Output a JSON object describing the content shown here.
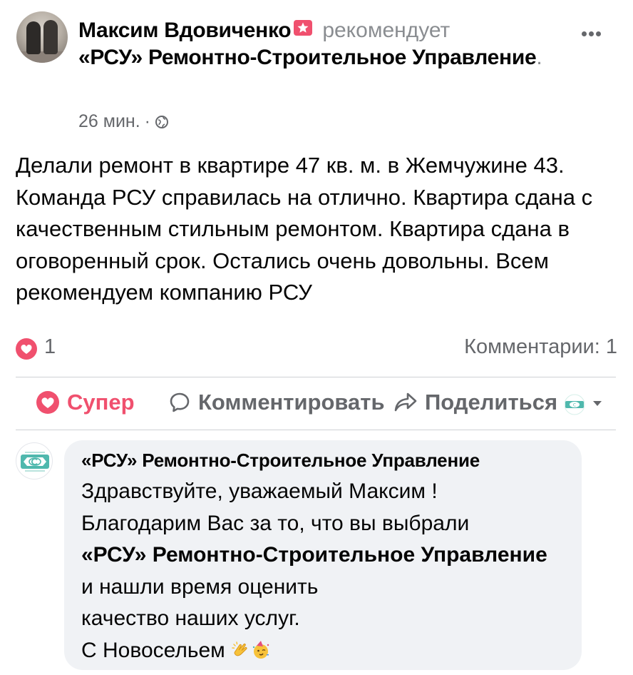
{
  "post": {
    "author": "Максим Вдовиченко",
    "verb": "рекомендует",
    "page_name": "«РСУ» Ремонтно-Строительное Управление",
    "page_suffix": ".",
    "time": "26 мин.",
    "time_separator": "·",
    "text": "Делали ремонт в квартире 47 кв. м. в Жемчужине 43. Команда РСУ справилась на отлично. Квартира сдана с качественным стильным ремонтом. Квартира сдана в оговоренный срок. Остались очень довольны. Всем рекомендуем компанию РСУ",
    "reaction_count": "1",
    "comments_count": "Комментарии: 1"
  },
  "actions": {
    "super_label": "Супер",
    "comment_label": "Комментировать",
    "share_label": "Поделиться"
  },
  "reply": {
    "author": "«РСУ» Ремонтно-Строительное Управление",
    "line1": "Здравствуйте, уважаемый Максим !",
    "line2": "Благодарим Вас за то, что вы выбрали",
    "bold_name": "«РСУ» Ремонтно-Строительное Управление",
    "line3_rest": " и нашли время оценить",
    "line4": "качество наших услуг.",
    "line5": "С Новосельем "
  },
  "colors": {
    "accent_red": "#f0506e",
    "secondary_text": "#65676b",
    "bubble_bg": "#f0f2f5",
    "logo_teal": "#4fb8ad"
  },
  "icons": {
    "star_badge": "star-badge-icon",
    "globe": "globe-icon",
    "more": "more-dots-icon",
    "heart": "heart-icon",
    "comment": "comment-bubble-icon",
    "share": "share-arrow-icon",
    "clap_emoji": "clapping-hands-emoji",
    "party_emoji": "partying-face-emoji"
  }
}
